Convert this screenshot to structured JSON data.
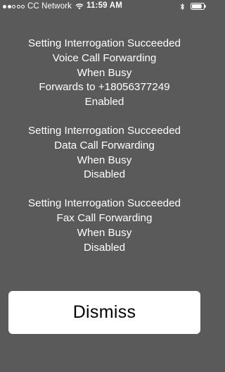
{
  "status_bar": {
    "signal_filled": 2,
    "signal_total": 5,
    "carrier": "CC Network",
    "time": "11:59 AM",
    "wifi_icon": "wifi-icon",
    "bluetooth_icon": "bluetooth-icon",
    "battery_icon": "battery-icon",
    "battery_level_fraction": 0.85
  },
  "messages": [
    {
      "lines": [
        "Setting Interrogation Succeeded",
        "Voice Call Forwarding",
        "When Busy",
        "Forwards to +18056377249",
        "Enabled"
      ]
    },
    {
      "lines": [
        "Setting Interrogation Succeeded",
        "Data Call Forwarding",
        "When Busy",
        "Disabled"
      ]
    },
    {
      "lines": [
        "Setting Interrogation Succeeded",
        "Fax Call Forwarding",
        "When Busy",
        "Disabled"
      ]
    }
  ],
  "dismiss_button": {
    "label": "Dismiss"
  },
  "colors": {
    "background": "#5a5a5a",
    "text": "#ffffff",
    "button_background": "#ffffff",
    "button_text": "#000000"
  }
}
